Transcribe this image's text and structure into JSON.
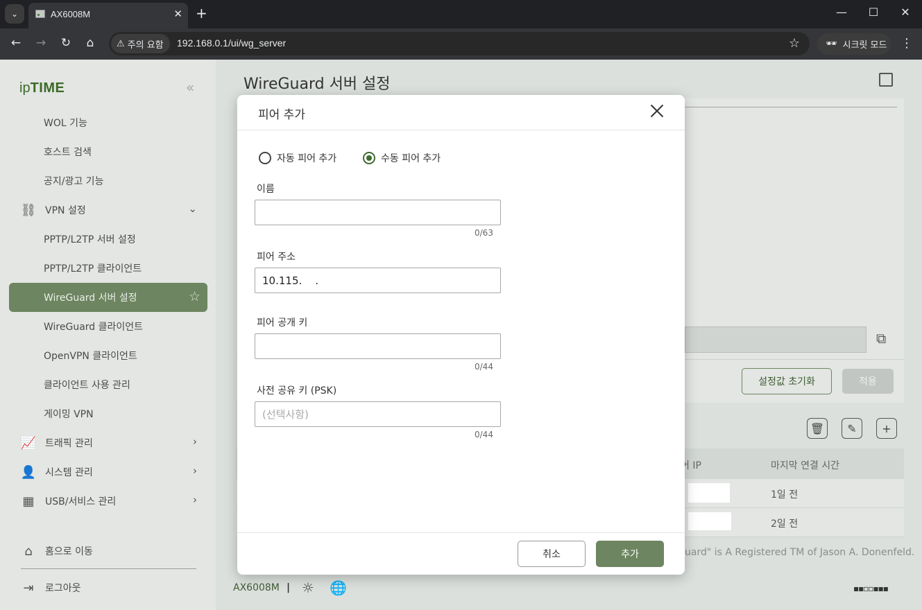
{
  "browser": {
    "tab_title": "AX6008M",
    "warning_chip": "주의 요함",
    "url": "192.168.0.1/ui/wg_server",
    "incognito_label": "시크릿 모드",
    "icons": [
      "tab-list-icon",
      "close-icon",
      "plus-icon",
      "minimize-icon",
      "maximize-icon",
      "back-icon",
      "forward-icon",
      "reload-icon",
      "home-icon",
      "warning-icon",
      "star-icon",
      "incognito-icon",
      "kebab-menu-icon"
    ]
  },
  "sidebar": {
    "logo_ip": "ip",
    "logo_time": "TIME",
    "items": [
      {
        "label": "WOL 기능"
      },
      {
        "label": "호스트 검색"
      },
      {
        "label": "공지/광고 기능"
      },
      {
        "label": "VPN 설정"
      },
      {
        "label": "PPTP/L2TP 서버 설정"
      },
      {
        "label": "PPTP/L2TP 클라이언트"
      },
      {
        "label": "WireGuard 서버 설정"
      },
      {
        "label": "WireGuard 클라이언트"
      },
      {
        "label": "OpenVPN 클라이언트"
      },
      {
        "label": "클라이언트 사용 관리"
      },
      {
        "label": "게이밍 VPN"
      },
      {
        "label": "트래픽 관리"
      },
      {
        "label": "시스템 관리"
      },
      {
        "label": "USB/서비스 관리"
      }
    ],
    "home_label": "홈으로 이동",
    "logout_label": "로그아웃"
  },
  "main": {
    "title": "WireGuard 서버 설정",
    "reset_button": "설정값 초기화",
    "apply_button": "적용",
    "table_headers": [
      "어 IP",
      "마지막 연결 시간"
    ],
    "rows": [
      {
        "last_seen": "1일 전"
      },
      {
        "last_seen": "2일 전"
      }
    ],
    "footer_text": "uard\" is A Registered TM of Jason A. Donenfeld.",
    "model": "AX6008M",
    "separator": "|"
  },
  "dialog": {
    "title": "피어 추가",
    "radio_auto": "자동 피어 추가",
    "radio_manual": "수동 피어 추가",
    "selected_mode": "manual",
    "name_label": "이름",
    "name_value": "",
    "name_counter": "0/63",
    "peer_address_label": "피어 주소",
    "peer_address_value": "10.115.    .",
    "public_key_label": "피어 공개 키",
    "public_key_value": "",
    "public_key_counter": "0/44",
    "psk_label": "사전 공유 키 (PSK)",
    "psk_placeholder": "(선택사항)",
    "psk_counter": "0/44",
    "cancel_button": "취소",
    "add_button": "추가"
  },
  "colors": {
    "accent": "#6d8560",
    "active_nav": "#6d8560",
    "radio_selected": "#3f6b30"
  }
}
